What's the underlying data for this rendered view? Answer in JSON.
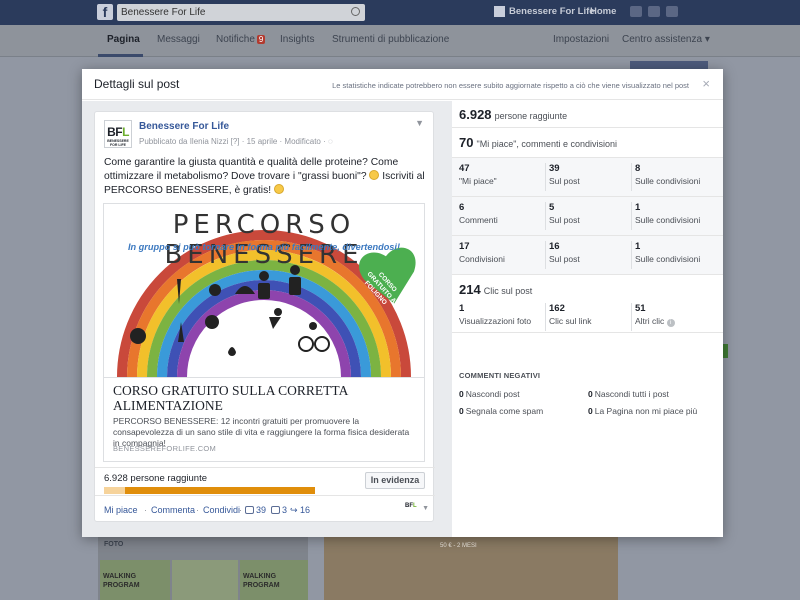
{
  "topbar": {
    "logo": "f",
    "search_value": "Benessere For Life",
    "page_name": "Benessere For Life",
    "home_label": "Home"
  },
  "subnav": {
    "items": [
      {
        "label": "Pagina"
      },
      {
        "label": "Messaggi"
      },
      {
        "label": "Notifiche"
      },
      {
        "label": "Insights"
      },
      {
        "label": "Strumenti di pubblicazione"
      }
    ],
    "notif_count": "9",
    "settings_label": "Impostazioni",
    "help_label": "Centro assistenza ▾"
  },
  "background": {
    "photos_label": "FOTO",
    "thumb1": "WALKING PROGRAM",
    "thumb2": "",
    "thumb3": "WALKING PROGRAM",
    "promo_price": "50 € - 2 MESI"
  },
  "modal": {
    "title": "Dettagli sul post",
    "note": "Le statistiche indicate potrebbero non essere subito aggiornate rispetto a ciò che viene visualizzato nel post",
    "close": "×"
  },
  "post": {
    "avatar_b": "BF",
    "avatar_l": "L",
    "avatar_sub": "BENESSERE FOR LIFE",
    "page_name": "Benessere For Life",
    "meta": "Pubblicato da Ilenia Nizzi [?] · 15 aprile · Modificato · ◌",
    "text_1": "Come garantire la giusta quantità e qualità delle proteine? Come ottimizzare il metabolismo? Dove trovare i \"grassi buoni\"? ",
    "text_2": " Iscriviti al PERCORSO BENESSERE, è gratis! ",
    "image_title": "PERCORSO BENESSERE",
    "image_subtitle": "In gruppo si può tornare in forma più facilmente, divertendosi!",
    "heart_text": "CORSO GRATUITO A FOLIGNO",
    "link_title": "CORSO GRATUITO SULLA CORRETTA ALIMENTAZIONE",
    "link_desc": "PERCORSO BENESSERE: 12 incontri gratuiti per promuovere la consapevolezza di un sano stile di vita e raggiungere la forma fisica desiderata in compagnia!",
    "link_domain": "BENESSEREFORLIFE.COM",
    "reach_label": "6.928 persone raggiunte",
    "organic_fraction": 0.1,
    "boost_label": "In evidenza",
    "actions": {
      "like": "Mi piace",
      "comment": "Commenta",
      "share": "Condividi",
      "likes_count": "39",
      "comments_count": "3",
      "shares_count": "16"
    }
  },
  "stats": {
    "reach_num": "6.928",
    "reach_label": "persone raggiunte",
    "engagement_num": "70",
    "engagement_label": "\"Mi piace\", commenti e condivisioni",
    "rows": [
      [
        {
          "num": "47",
          "label": "\"Mi piace\""
        },
        {
          "num": "39",
          "label": "Sul post"
        },
        {
          "num": "8",
          "label": "Sulle condivisioni"
        }
      ],
      [
        {
          "num": "6",
          "label": "Commenti"
        },
        {
          "num": "5",
          "label": "Sul post"
        },
        {
          "num": "1",
          "label": "Sulle condivisioni"
        }
      ],
      [
        {
          "num": "17",
          "label": "Condivisioni"
        },
        {
          "num": "16",
          "label": "Sul post"
        },
        {
          "num": "1",
          "label": "Sulle condivisioni"
        }
      ]
    ],
    "clicks_num": "214",
    "clicks_label": "Clic sul post",
    "click_cells": [
      {
        "num": "1",
        "label": "Visualizzazioni foto"
      },
      {
        "num": "162",
        "label": "Clic sul link"
      },
      {
        "num": "51",
        "label": "Altri clic"
      }
    ],
    "negative_title": "COMMENTI NEGATIVI",
    "negative": [
      {
        "num": "0",
        "label": "Nascondi post"
      },
      {
        "num": "0",
        "label": "Nascondi tutti i post"
      },
      {
        "num": "0",
        "label": "Segnala come spam"
      },
      {
        "num": "0",
        "label": "La Pagina non mi piace più"
      }
    ]
  },
  "colors": {
    "fb_blue": "#365899",
    "reach_paid": "#e08e0b",
    "reach_organic": "#f6d39b",
    "heart_green": "#4caf50"
  }
}
